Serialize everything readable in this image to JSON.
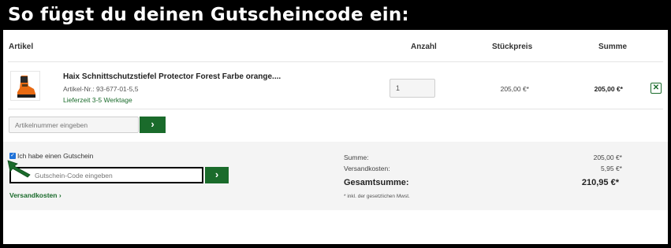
{
  "banner": {
    "title": "So fügst du deinen Gutscheincode ein:"
  },
  "table": {
    "col_article": "Artikel",
    "col_qty": "Anzahl",
    "col_unit_price": "Stückpreis",
    "col_sum": "Summe"
  },
  "item": {
    "name": "Haix Schnittschutzstiefel Protector Forest Farbe orange....",
    "sku": "Artikel-Nr.: 93-677-01-5,5",
    "delivery": "Lieferzeit 3-5 Werktage",
    "quantity": "1",
    "unit_price": "205,00 €*",
    "line_total": "205,00 €*",
    "remove_glyph": "✕"
  },
  "article_add": {
    "placeholder": "Artikelnummer eingeben",
    "button_glyph": "›"
  },
  "voucher": {
    "checkbox_label": "Ich habe einen Gutschein",
    "checkbox_glyph": "✓",
    "code_placeholder": "Gutschein-Code eingeben",
    "button_glyph": "›"
  },
  "shipping_link": "Versandkosten ›",
  "summary": {
    "subtotal_label": "Summe:",
    "subtotal_value": "205,00 €*",
    "shipping_label": "Versandkosten:",
    "shipping_value": "5,95 €*",
    "total_label": "Gesamtsumme:",
    "total_value": "210,95 €*",
    "vat_note": "* inkl. der gesetzlichen Mwst."
  },
  "colors": {
    "brand_green": "#1a6b2b",
    "checkbox_blue": "#1f72d8",
    "banner_bg": "#000000"
  },
  "icons": {
    "product": "boot-thumbnail",
    "arrow": "pointer-arrow-icon",
    "remove": "close-icon",
    "submit": "chevron-right-icon"
  }
}
